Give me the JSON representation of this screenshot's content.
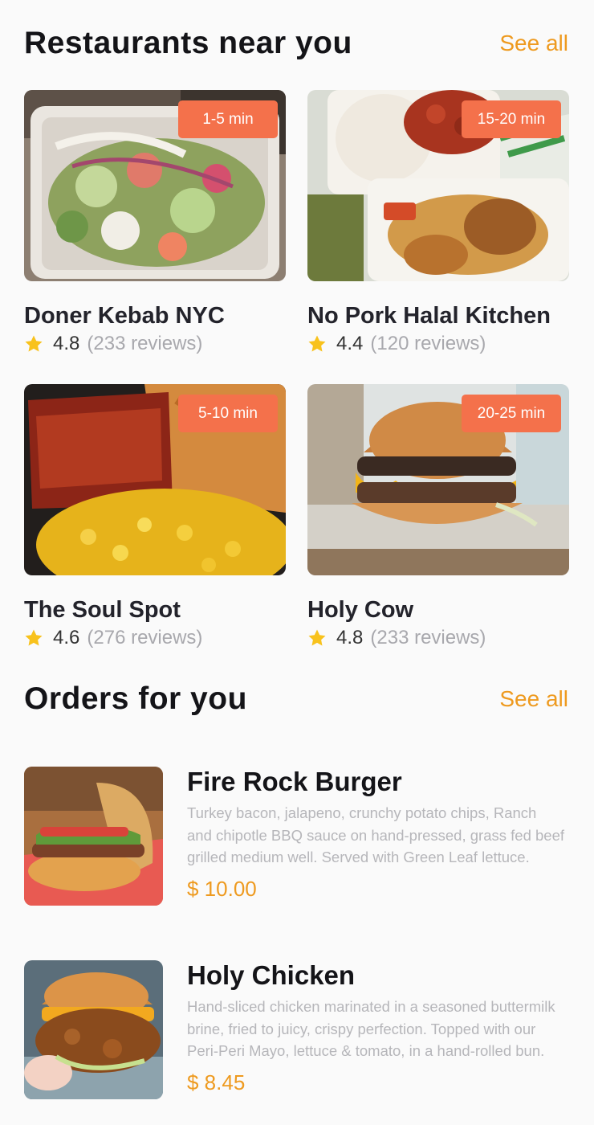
{
  "restaurants_section": {
    "title": "Restaurants near you",
    "see_all": "See all",
    "items": [
      {
        "name": "Doner Kebab NYC",
        "rating": "4.8",
        "reviews": "(233 reviews)",
        "time": "1-5 min"
      },
      {
        "name": "No Pork Halal Kitchen",
        "rating": "4.4",
        "reviews": "(120 reviews)",
        "time": "15-20 min"
      },
      {
        "name": "The Soul Spot",
        "rating": "4.6",
        "reviews": "(276 reviews)",
        "time": "5-10 min"
      },
      {
        "name": "Holy Cow",
        "rating": "4.8",
        "reviews": "(233 reviews)",
        "time": "20-25 min"
      }
    ]
  },
  "orders_section": {
    "title": "Orders for you",
    "see_all": "See all",
    "items": [
      {
        "name": "Fire Rock Burger",
        "description": "Turkey bacon, jalapeno, crunchy potato chips, Ranch and chipotle BBQ sauce on hand-pressed, grass fed beef grilled medium well. Served with Green Leaf lettuce.",
        "price": "$ 10.00"
      },
      {
        "name": "Holy Chicken",
        "description": "Hand-sliced chicken marinated in a seasoned buttermilk brine, fried to juicy, crispy perfection. Topped with our Peri-Peri Mayo, lettuce & tomato, in a hand-rolled bun.",
        "price": "$ 8.45"
      }
    ]
  },
  "colors": {
    "accent": "#ee9a1f",
    "badge": "#f4714b",
    "star": "#f8c21c",
    "muted": "#a8a8ad"
  },
  "icons": {
    "rating": "star-icon"
  }
}
